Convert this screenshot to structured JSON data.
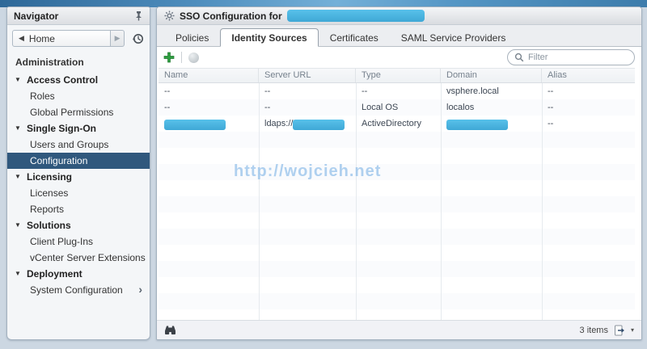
{
  "navigator": {
    "title": "Navigator",
    "home_label": "Home",
    "section_label": "Administration",
    "tree": [
      {
        "label": "Access Control",
        "type": "category"
      },
      {
        "label": "Roles",
        "type": "item"
      },
      {
        "label": "Global Permissions",
        "type": "item"
      },
      {
        "label": "Single Sign-On",
        "type": "category"
      },
      {
        "label": "Users and Groups",
        "type": "item"
      },
      {
        "label": "Configuration",
        "type": "item",
        "selected": true
      },
      {
        "label": "Licensing",
        "type": "category"
      },
      {
        "label": "Licenses",
        "type": "item"
      },
      {
        "label": "Reports",
        "type": "item"
      },
      {
        "label": "Solutions",
        "type": "category"
      },
      {
        "label": "Client Plug-Ins",
        "type": "item"
      },
      {
        "label": "vCenter Server Extensions",
        "type": "item"
      },
      {
        "label": "Deployment",
        "type": "category"
      },
      {
        "label": "System Configuration",
        "type": "item",
        "chevron": true
      }
    ]
  },
  "main": {
    "title": "SSO Configuration for",
    "title_value_redacted": true,
    "tabs": [
      {
        "label": "Policies"
      },
      {
        "label": "Identity Sources",
        "active": true
      },
      {
        "label": "Certificates"
      },
      {
        "label": "SAML Service Providers"
      }
    ],
    "toolbar": {
      "filter_placeholder": "Filter"
    },
    "table": {
      "columns": [
        "Name",
        "Server URL",
        "Type",
        "Domain",
        "Alias"
      ],
      "rows": [
        {
          "name": {
            "text": "--"
          },
          "server_url": {
            "text": "--"
          },
          "type": {
            "text": "--"
          },
          "domain": {
            "text": "vsphere.local"
          },
          "alias": {
            "text": "--"
          }
        },
        {
          "name": {
            "text": "--"
          },
          "server_url": {
            "text": "--"
          },
          "type": {
            "text": "Local OS"
          },
          "domain": {
            "text": "localos"
          },
          "alias": {
            "text": "--"
          }
        },
        {
          "name": {
            "redacted": true,
            "redacted_width": 76
          },
          "server_url": {
            "prefix": "ldaps://",
            "redacted": true,
            "redacted_width": 64
          },
          "type": {
            "text": "ActiveDirectory"
          },
          "domain": {
            "redacted": true,
            "redacted_width": 76
          },
          "alias": {
            "text": "--"
          }
        }
      ]
    },
    "status": {
      "items_count": "3 items"
    }
  },
  "watermark": "http://wojcieh.net",
  "icons": {
    "pin": "pushpin-icon",
    "back": "back-arrow-icon",
    "forward": "forward-arrow-icon",
    "history": "recent-objects-clock-icon",
    "sso": "gear-icon",
    "add": "green-plus-icon",
    "edit_disabled": "disabled-globe-icon",
    "search": "magnifier-icon",
    "find": "binoculars-icon",
    "export": "export-icon"
  },
  "colors": {
    "redaction_blue": "#4ab5e2",
    "selected_item": "#30587d",
    "add_green": "#2f9e41",
    "watermark_blue": "#7db4e6",
    "top_band_blue": "#4e8dbd"
  }
}
